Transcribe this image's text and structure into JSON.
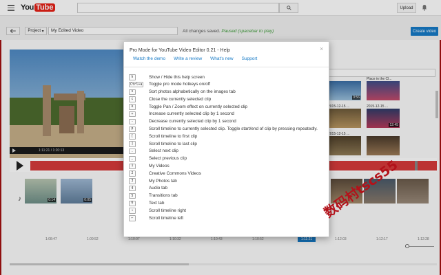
{
  "topbar": {
    "logo_you": "You",
    "logo_tube": "Tube",
    "upload_label": "Upload"
  },
  "editor": {
    "project_label": "Project",
    "title_value": "My Edited Video",
    "save_status": "All changes saved.",
    "paused_status": "Paused (spacebar to play)",
    "create_label": "Create video"
  },
  "player": {
    "time": "1:11:21 / 1:20:13"
  },
  "library": {
    "thumbs": [
      {
        "label": "",
        "duration": "0:56"
      },
      {
        "label": "Place in the Cl...",
        "duration": ""
      },
      {
        "label": "2015-12-15 ...",
        "duration": "12:45"
      },
      {
        "label": "2015-12-15 ...",
        "duration": ""
      },
      {
        "label": "2015-12-15 ...",
        "duration": ""
      }
    ]
  },
  "timeline": {
    "clips": [
      {
        "duration": "0:14"
      },
      {
        "duration": "0:05"
      }
    ],
    "ticks": [
      "1:08:47",
      "1:09:52",
      "1:10:07",
      "1:10:32",
      "1:10:43",
      "1:10:52",
      "1:12:03",
      "1:12:17",
      "1:12:28"
    ],
    "playhead": "1:11:21"
  },
  "modal": {
    "title": "Pro Mode for YouTube Video Editor 0.21 - Help",
    "links": [
      "Watch the demo",
      "Write a review",
      "What's new",
      "Support"
    ],
    "shortcuts": [
      {
        "key": "h",
        "desc": "Show / Hide this help screen"
      },
      {
        "key": "Ctrl+a",
        "desc": "Toggle pro mode hotkeys on/off"
      },
      {
        "key": "s",
        "desc": "Sort photos alphabetically on the images tab"
      },
      {
        "key": "c",
        "desc": "Close the currently selected clip"
      },
      {
        "key": "k",
        "desc": "Toggle Pan / Zoom effect on currently selected clip"
      },
      {
        "key": "+",
        "desc": "Increase currently selected clip by 1 second"
      },
      {
        "key": "-",
        "desc": "Decrease currently selected clip by 1 second"
      },
      {
        "key": "p",
        "desc": "Scroll timeline to currently selected clip. Toggle start/end of clip by pressing repeatedly."
      },
      {
        "key": "[",
        "desc": "Scroll timeline to first clip"
      },
      {
        "key": "]",
        "desc": "Scroll timeline to last clip"
      },
      {
        "key": ".",
        "desc": "Select next clip"
      },
      {
        "key": ",",
        "desc": "Select previous clip"
      },
      {
        "key": "1",
        "desc": "My Videos"
      },
      {
        "key": "2",
        "desc": "Creative Commons Videos"
      },
      {
        "key": "3",
        "desc": "My Photos tab"
      },
      {
        "key": "4",
        "desc": "Audio tab"
      },
      {
        "key": "5",
        "desc": "Transitions tab"
      },
      {
        "key": "6",
        "desc": "Text tab"
      },
      {
        "key": "→",
        "desc": "Scroll timeline right"
      },
      {
        "key": "←",
        "desc": "Scroll timeline left"
      }
    ]
  },
  "watermark": "数码村tscs55",
  "colors": {
    "accent": "#167ac6",
    "timeline_red": "#d73b3b",
    "youtube_red": "#e62117"
  }
}
